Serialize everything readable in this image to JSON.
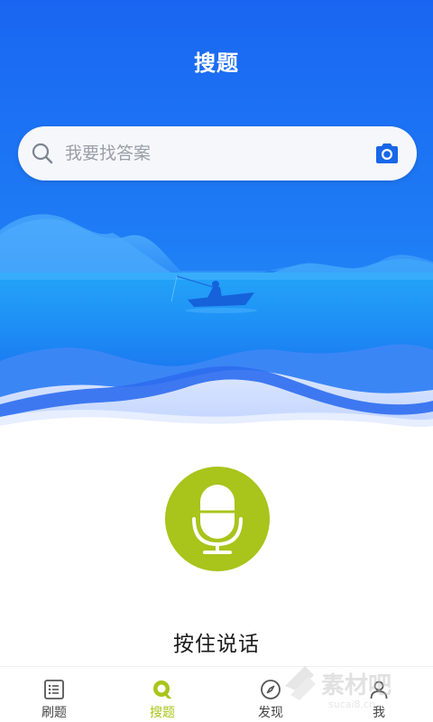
{
  "header": {
    "title": "搜题"
  },
  "search": {
    "placeholder": "我要找答案"
  },
  "voice": {
    "hold_to_speak_label": "按住说话"
  },
  "tabbar": {
    "items": [
      {
        "label": "刷题",
        "icon": "list-icon",
        "active": false
      },
      {
        "label": "搜题",
        "icon": "search-tab-icon",
        "active": true
      },
      {
        "label": "发现",
        "icon": "compass-icon",
        "active": false
      },
      {
        "label": "我",
        "icon": "user-icon",
        "active": false
      }
    ]
  },
  "watermark": {
    "brand_text": "素材吧",
    "url_text": "sucai8.cn"
  },
  "colors": {
    "primary_blue": "#1e6ff5",
    "accent_green": "#a9c41b",
    "camera_blue": "#1767e8"
  }
}
